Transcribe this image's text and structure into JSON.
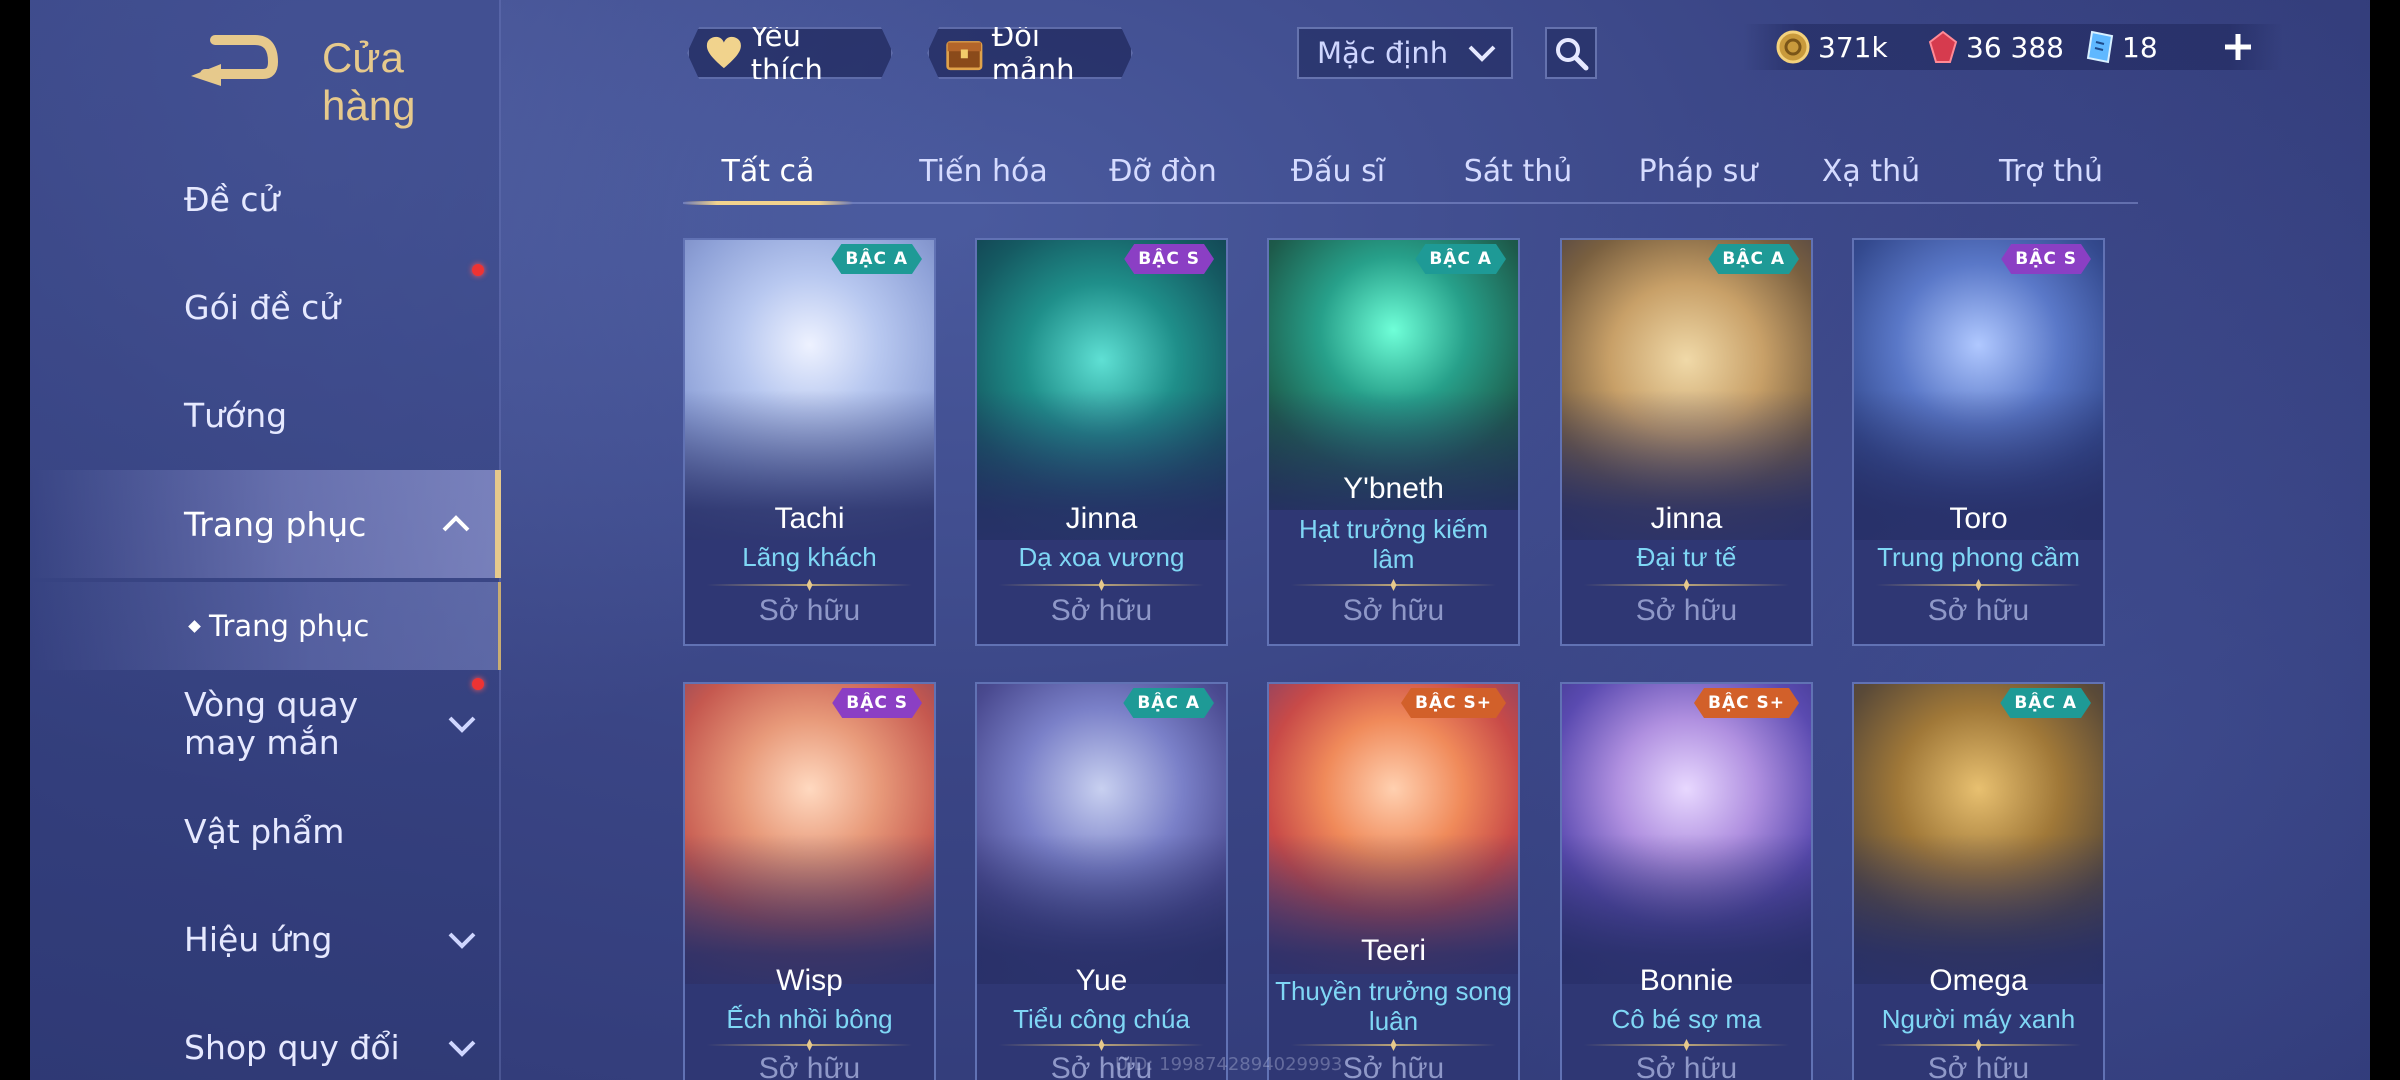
{
  "header": {
    "title": "Cửa hàng",
    "favorites_label": "Yêu thích",
    "exchange_label": "Đổi mảnh",
    "sort_value": "Mặc định"
  },
  "currencies": [
    {
      "icon": "gold-coin-icon",
      "value": "371k"
    },
    {
      "icon": "ruby-icon",
      "value": "36 388"
    },
    {
      "icon": "voucher-icon",
      "value": "18"
    }
  ],
  "sidebar": {
    "items": [
      {
        "label": "Đề cử"
      },
      {
        "label": "Gói đề cử"
      },
      {
        "label": "Tướng"
      },
      {
        "label": "Trang phục"
      },
      {
        "label": "Trang phục"
      },
      {
        "label": "Vòng quay may mắn"
      },
      {
        "label": "Vật phẩm"
      },
      {
        "label": "Hiệu ứng"
      },
      {
        "label": "Shop quy đổi"
      }
    ]
  },
  "tabs": [
    {
      "label": "Tất cả"
    },
    {
      "label": "Tiến hóa"
    },
    {
      "label": "Đỡ đòn"
    },
    {
      "label": "Đấu sĩ"
    },
    {
      "label": "Sát thủ"
    },
    {
      "label": "Pháp sư"
    },
    {
      "label": "Xạ thủ"
    },
    {
      "label": "Trợ thủ"
    }
  ],
  "cards": [
    {
      "hero": "Tachi",
      "skin": "Lãng khách",
      "tier": "BẬC A",
      "status": "Sở hữu"
    },
    {
      "hero": "Jinna",
      "skin": "Dạ xoa vương",
      "tier": "BẬC S",
      "status": "Sở hữu"
    },
    {
      "hero": "Y'bneth",
      "skin": "Hạt trưởng kiếm lâm",
      "tier": "BẬC A",
      "status": "Sở hữu"
    },
    {
      "hero": "Jinna",
      "skin": "Đại tư tế",
      "tier": "BẬC A",
      "status": "Sở hữu"
    },
    {
      "hero": "Toro",
      "skin": "Trung phong cầm",
      "tier": "BẬC S",
      "status": "Sở hữu"
    },
    {
      "hero": "Wisp",
      "skin": "Ếch nhồi bông",
      "tier": "BẬC S",
      "status": "Sở hữu"
    },
    {
      "hero": "Yue",
      "skin": "Tiểu công chúa",
      "tier": "BẬC A",
      "status": "Sở hữu"
    },
    {
      "hero": "Teeri",
      "skin": "Thuyền trưởng song luân",
      "tier": "BẬC S+",
      "status": "Sở hữu"
    },
    {
      "hero": "Bonnie",
      "skin": "Cô bé sợ ma",
      "tier": "BẬC S+",
      "status": "Sở hữu"
    },
    {
      "hero": "Omega",
      "skin": "Người máy xanh",
      "tier": "BẬC A",
      "status": "Sở hữu"
    }
  ],
  "watermark": "UID: 1998742894029993",
  "colors": {
    "gold": "#e6c98c",
    "skin_text": "#7fd7f5",
    "tier_a": "#1e9a96",
    "tier_s": "#8b3fc4",
    "tier_s_plus": "#d2602a"
  }
}
